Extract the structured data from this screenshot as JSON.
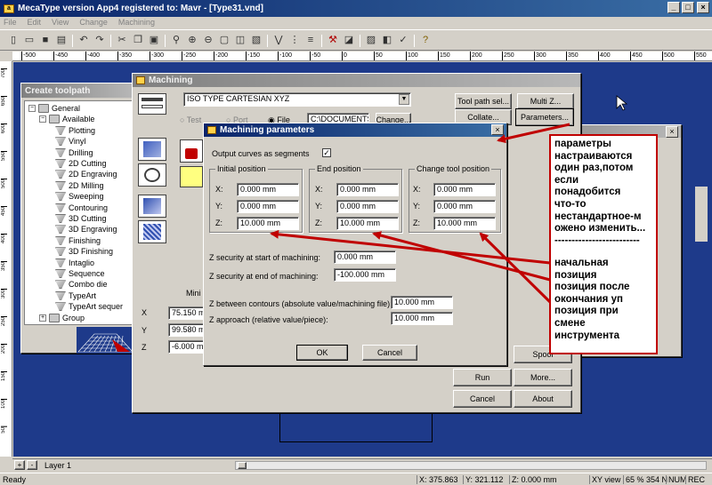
{
  "app": {
    "title": "MecaType  version  App4 registered to: Mavr  - [Type31.vnd]",
    "menu": [
      "File",
      "Edit",
      "View",
      "Change",
      "Machining"
    ],
    "status_left": "Ready",
    "status": {
      "x": "X: 375.863",
      "y": "Y: 321.112",
      "z": "Z: 0.000 mm",
      "view": "XY view",
      "zoom": "65 % 354 N",
      "num": "NUM",
      "rec": "REC"
    },
    "layer": "Layer 1",
    "ruler_ticks": [
      "-500",
      "-450",
      "-400",
      "-350",
      "-300",
      "-250",
      "-200",
      "-150",
      "-100",
      "-50",
      "0",
      "50",
      "100",
      "150",
      "200",
      "250",
      "300",
      "350",
      "400",
      "450",
      "500",
      "550"
    ],
    "vruler_ticks": [
      "700",
      "650",
      "600",
      "550",
      "500",
      "450",
      "400",
      "350",
      "300",
      "250",
      "200",
      "150",
      "100",
      "50"
    ]
  },
  "toolpath": {
    "title": "Create toolpath",
    "general": "General",
    "available": "Available",
    "items": [
      "Plotting",
      "Vinyl",
      "Drilling",
      "2D Cutting",
      "2D Engraving",
      "2D Milling",
      "Sweeping",
      "Contouring",
      "3D Cutting",
      "3D Engraving",
      "Finishing",
      "3D Finishing",
      "Intaglio",
      "Sequence",
      "Combo die",
      "TypeArt",
      "TypeArt sequer"
    ],
    "group": "Group"
  },
  "machining": {
    "title": "Machining",
    "machine": "ISO TYPE CARTESIAN XYZ",
    "radio_test": "Test",
    "radio_port": "Port",
    "radio_file": "File",
    "file_path": "C:\\DOCUMENTS",
    "change": "Change...",
    "tool_path_sel": "Tool path sel...",
    "multi_z": "Multi Z...",
    "collate": "Collate...",
    "parameters": "Parameters...",
    "mini_label": "Mini",
    "x_label": "X",
    "y_label": "Y",
    "z_label": "Z",
    "x_value": "75.150 m",
    "y_value": "99.580 m",
    "z_value": "-6.000 m",
    "spool": "Spool",
    "run": "Run",
    "more": "More...",
    "cancel": "Cancel",
    "about": "About"
  },
  "params": {
    "title": "Machining parameters",
    "output_curves": "Output curves as segments",
    "initial_title": "Initial position",
    "end_title": "End position",
    "change_title": "Change tool position",
    "x": "X:",
    "y": "Y:",
    "z": "Z:",
    "initial": {
      "x": "0.000 mm",
      "y": "0.000 mm",
      "z": "10.000 mm"
    },
    "end": {
      "x": "0.000 mm",
      "y": "0.000 mm",
      "z": "10.000 mm"
    },
    "change": {
      "x": "0.000 mm",
      "y": "0.000 mm",
      "z": "10.000 mm"
    },
    "zsec_start_label": "Z security at start of machining:",
    "zsec_start": "0.000 mm",
    "zsec_end_label": "Z security at end of machining:",
    "zsec_end": "-100.000 mm",
    "zbetween_label": "Z between contours (absolute value/machining file):",
    "zbetween": "10.000 mm",
    "zapproach_label": "Z approach (relative value/piece):",
    "zapproach": "10.000 mm",
    "ok": "OK",
    "cancel": "Cancel"
  },
  "annotation": {
    "top": "параметры\nнастраиваются\nодин раз,потом\nесли\nпонадобится\nчто-то\nнестандартное-м\nожено изменить...\n-------------------------",
    "bottom": "начальная\nпозиция\nпозиция после\nокончания уп\nпозиция при\nсмене\nинструмента"
  },
  "colors": {
    "accent": "#0a246a",
    "annotation": "#c00000",
    "canvas": "#1e3a8a"
  }
}
